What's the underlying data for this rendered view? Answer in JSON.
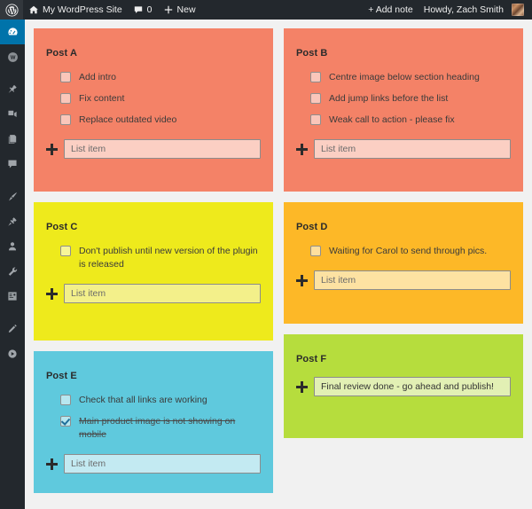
{
  "adminbar": {
    "logo_icon": "wordpress-logo-icon",
    "site_home_icon": "home-icon",
    "site_name": "My WordPress Site",
    "comments_icon": "comment-bubble-icon",
    "comments_count": "0",
    "new_icon": "plus-icon",
    "new_label": "New",
    "add_note_label": "+ Add note",
    "howdy_label": "Howdy, Zach Smith",
    "avatar_name": "user-avatar"
  },
  "sidebar": {
    "items": [
      {
        "name": "dashboard",
        "icon": "dashboard-icon",
        "current": true
      },
      {
        "name": "site-logo",
        "icon": "site-circle-icon",
        "current": false
      },
      {
        "name": "posts",
        "icon": "pin-icon",
        "current": false
      },
      {
        "name": "media",
        "icon": "media-icon",
        "current": false
      },
      {
        "name": "pages",
        "icon": "pages-icon",
        "current": false
      },
      {
        "name": "comments",
        "icon": "comment-bubble-icon",
        "current": false
      },
      {
        "name": "appearance",
        "icon": "paintbrush-icon",
        "current": false
      },
      {
        "name": "plugins",
        "icon": "plug-icon",
        "current": false
      },
      {
        "name": "users",
        "icon": "user-icon",
        "current": false
      },
      {
        "name": "tools",
        "icon": "wrench-icon",
        "current": false
      },
      {
        "name": "settings",
        "icon": "settings-sliders-icon",
        "current": false
      },
      {
        "name": "editor",
        "icon": "pencil-icon",
        "current": false
      },
      {
        "name": "media-player",
        "icon": "play-circle-icon",
        "current": false
      }
    ]
  },
  "board": {
    "input_placeholder": "List item",
    "notes": [
      {
        "id": "post-a",
        "title": "Post A",
        "color": "#f48267",
        "column": "left",
        "items": [
          {
            "label": "Add intro",
            "checked": false
          },
          {
            "label": "Fix content",
            "checked": false
          },
          {
            "label": "Replace outdated video",
            "checked": false
          }
        ],
        "input_value": ""
      },
      {
        "id": "post-b",
        "title": "Post B",
        "color": "#f48267",
        "column": "right",
        "items": [
          {
            "label": "Centre image below section heading",
            "checked": false
          },
          {
            "label": "Add jump links before the list",
            "checked": false
          },
          {
            "label": "Weak call to action - please fix",
            "checked": false
          }
        ],
        "input_value": ""
      },
      {
        "id": "post-c",
        "title": "Post C",
        "color": "#eeea1c",
        "column": "left",
        "items": [
          {
            "label": "Don't publish until new version of the plugin is released",
            "checked": false
          }
        ],
        "input_value": ""
      },
      {
        "id": "post-d",
        "title": "Post D",
        "color": "#fdb827",
        "column": "right",
        "items": [
          {
            "label": "Waiting for Carol to send through pics.",
            "checked": false
          }
        ],
        "input_value": ""
      },
      {
        "id": "post-e",
        "title": "Post E",
        "color": "#5fc9dd",
        "column": "left",
        "items": [
          {
            "label": "Check that all links are working",
            "checked": false
          },
          {
            "label": "Main product image is not showing on mobile",
            "checked": true
          }
        ],
        "input_value": ""
      },
      {
        "id": "post-f",
        "title": "Post F",
        "color": "#b6dd3d",
        "column": "right",
        "items": [],
        "input_value": "Final review done - go ahead and publish!"
      }
    ]
  }
}
